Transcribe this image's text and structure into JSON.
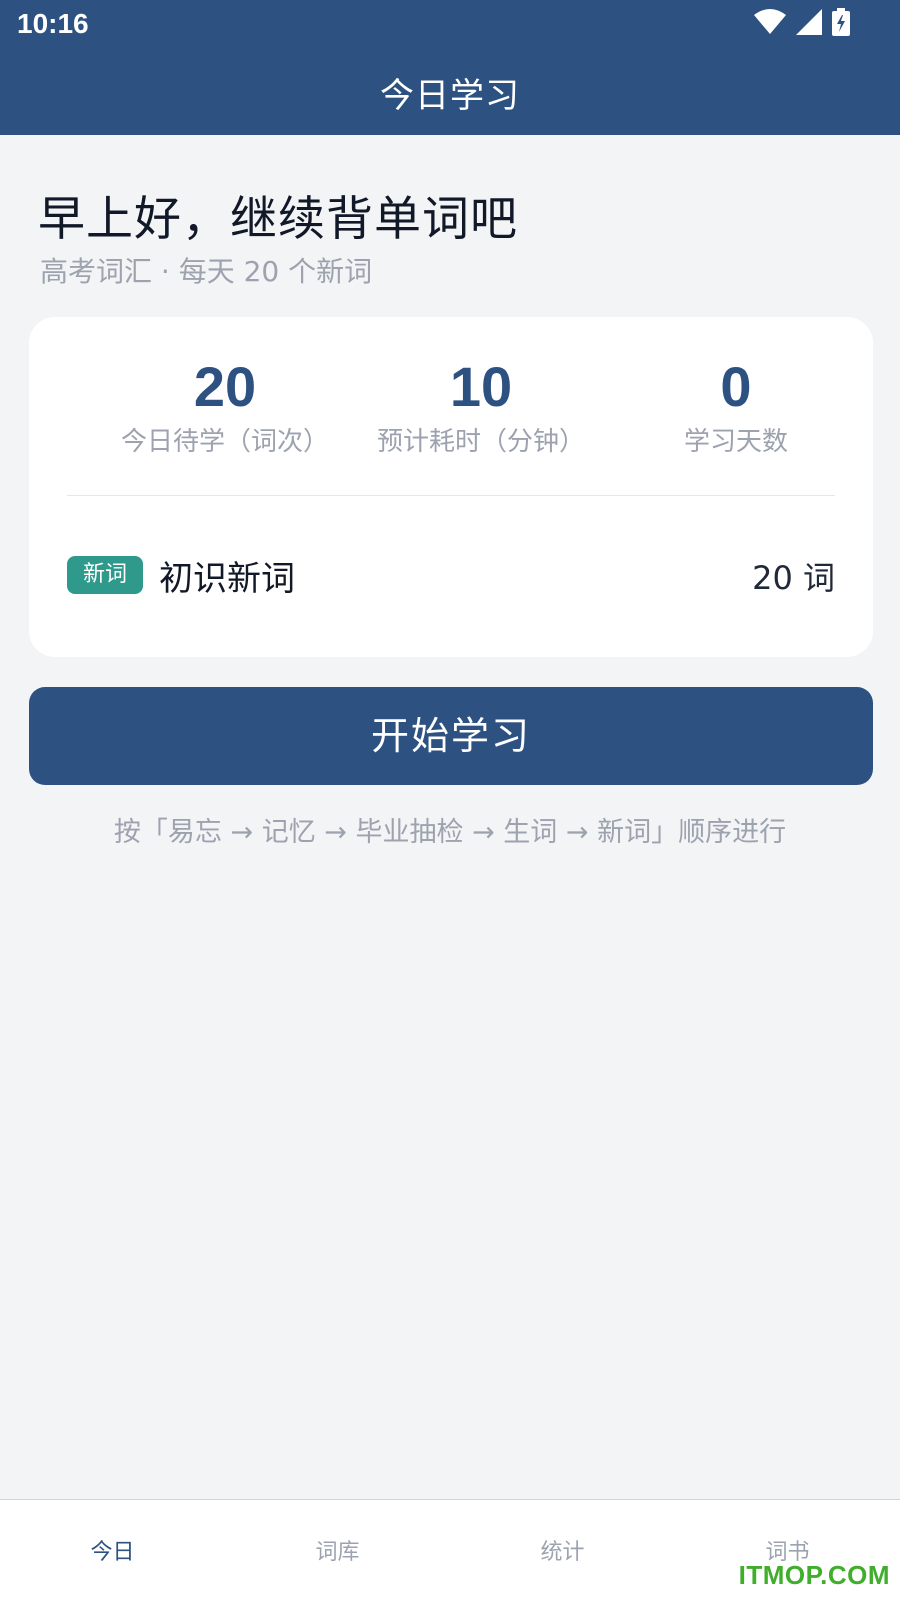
{
  "status_bar": {
    "time": "10:16",
    "icons": [
      "wifi-icon",
      "cell-signal-icon",
      "battery-charging-icon"
    ]
  },
  "header": {
    "title": "今日学习"
  },
  "greeting": {
    "title": "早上好，继续背单词吧",
    "subtitle": "高考词汇 · 每天 20 个新词"
  },
  "summary_card": {
    "stats": [
      {
        "value": "20",
        "label": "今日待学（词次）"
      },
      {
        "value": "10",
        "label": "预计耗时（分钟）"
      },
      {
        "value": "0",
        "label": "学习天数"
      }
    ],
    "rows": [
      {
        "badge": "新词",
        "label": "初识新词",
        "count": "20 词"
      }
    ]
  },
  "actions": {
    "start_label": "开始学习",
    "order_hint": "按「易忘 → 记忆 → 毕业抽检 → 生词 → 新词」顺序进行"
  },
  "bottom_nav": {
    "items": [
      {
        "label": "今日",
        "active": true
      },
      {
        "label": "词库",
        "active": false
      },
      {
        "label": "统计",
        "active": false
      },
      {
        "label": "词书",
        "active": false
      }
    ]
  },
  "watermark": "ITMOP.COM",
  "colors": {
    "primary": "#2d5282",
    "badge": "#2f9a8c",
    "background": "#f3f4f6",
    "muted_text": "#9ca3af",
    "watermark": "#3fae2a"
  }
}
